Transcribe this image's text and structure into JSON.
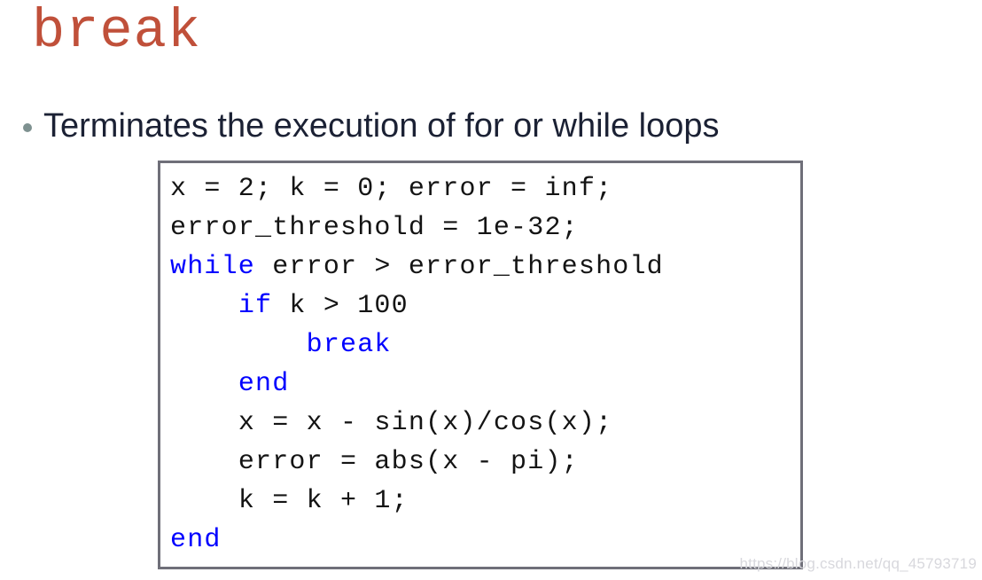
{
  "slide": {
    "title": "break",
    "title_color": "#c0503a",
    "background_color": "#ffffff"
  },
  "bullet": {
    "marker": "bullet-dot",
    "marker_color": "#7e9190",
    "text": "Terminates the execution of for or while loops",
    "text_color": "#1b2134"
  },
  "code_block": {
    "border_color": "#6f6f79",
    "text_color": "#141414",
    "keyword_color": "#0000ff",
    "language": "matlab",
    "lines": [
      {
        "indent": "",
        "segments": [
          {
            "text": "x = 2; k = 0; error = inf;",
            "kind": "plain"
          }
        ]
      },
      {
        "indent": "",
        "segments": [
          {
            "text": "error_threshold = 1e-32;",
            "kind": "plain"
          }
        ]
      },
      {
        "indent": "",
        "segments": [
          {
            "text": "while",
            "kind": "keyword"
          },
          {
            "text": " error > error_threshold",
            "kind": "plain"
          }
        ]
      },
      {
        "indent": "    ",
        "segments": [
          {
            "text": "if",
            "kind": "keyword"
          },
          {
            "text": " k > 100",
            "kind": "plain"
          }
        ]
      },
      {
        "indent": "        ",
        "segments": [
          {
            "text": "break",
            "kind": "keyword"
          }
        ]
      },
      {
        "indent": "    ",
        "segments": [
          {
            "text": "end",
            "kind": "keyword"
          }
        ]
      },
      {
        "indent": "    ",
        "segments": [
          {
            "text": "x = x - sin(x)/cos(x);",
            "kind": "plain"
          }
        ]
      },
      {
        "indent": "    ",
        "segments": [
          {
            "text": "error = abs(x - pi);",
            "kind": "plain"
          }
        ]
      },
      {
        "indent": "    ",
        "segments": [
          {
            "text": "k = k + 1;",
            "kind": "plain"
          }
        ]
      },
      {
        "indent": "",
        "segments": [
          {
            "text": "end",
            "kind": "keyword"
          }
        ]
      }
    ]
  },
  "watermark": {
    "text": "https://blog.csdn.net/qq_45793719",
    "color": "#d8d8dd"
  }
}
